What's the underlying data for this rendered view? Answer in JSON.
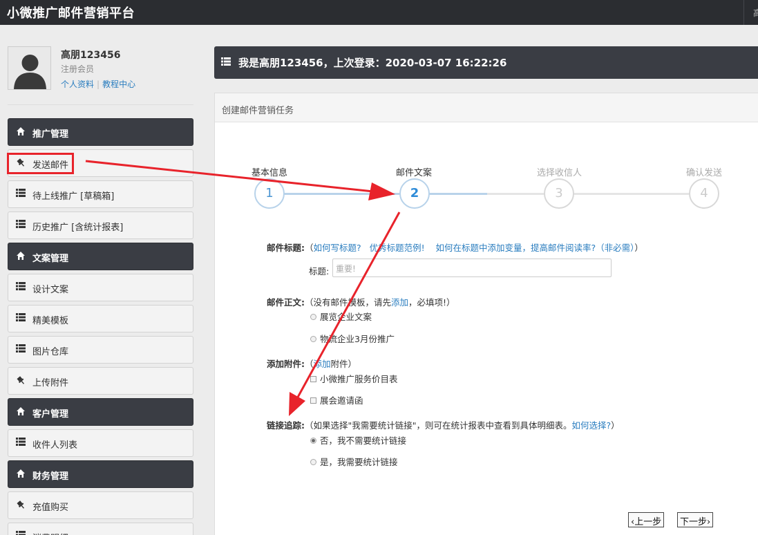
{
  "app": {
    "title": "小微推广邮件营销平台",
    "clipped_text": "高"
  },
  "profile": {
    "name": "高朋123456",
    "role": "注册会员",
    "link_profile": "个人资料",
    "link_tutorial": "教程中心",
    "separator": "|"
  },
  "sidebar": {
    "items": [
      {
        "label": "推广管理",
        "type": "head",
        "icon": "home-icon"
      },
      {
        "label": "发送邮件",
        "type": "item",
        "icon": "pushpin-icon"
      },
      {
        "label": "待上线推广 [草稿箱]",
        "type": "item",
        "icon": "list-icon"
      },
      {
        "label": "历史推广 [含统计报表]",
        "type": "item",
        "icon": "list-icon"
      },
      {
        "label": "文案管理",
        "type": "head",
        "icon": "home-icon"
      },
      {
        "label": "设计文案",
        "type": "item",
        "icon": "list-icon"
      },
      {
        "label": "精美模板",
        "type": "item",
        "icon": "list-icon"
      },
      {
        "label": "图片仓库",
        "type": "item",
        "icon": "list-icon"
      },
      {
        "label": "上传附件",
        "type": "item",
        "icon": "pushpin-icon"
      },
      {
        "label": "客户管理",
        "type": "head",
        "icon": "home-icon"
      },
      {
        "label": "收件人列表",
        "type": "item",
        "icon": "list-icon"
      },
      {
        "label": "财务管理",
        "type": "head",
        "icon": "home-icon"
      },
      {
        "label": "充值购买",
        "type": "item",
        "icon": "pushpin-icon"
      },
      {
        "label": "消费明细",
        "type": "item",
        "icon": "list-icon"
      }
    ]
  },
  "welcome": {
    "text": "我是高朋123456，上次登录：2020-03-07 16:22:26"
  },
  "panel": {
    "title": "创建邮件营销任务"
  },
  "steps": [
    {
      "label": "基本信息",
      "number": "1",
      "state": "done"
    },
    {
      "label": "邮件文案",
      "number": "2",
      "state": "active"
    },
    {
      "label": "选择收信人",
      "number": "3",
      "state": "todo"
    },
    {
      "label": "确认发送",
      "number": "4",
      "state": "todo"
    }
  ],
  "form": {
    "subject": {
      "label": "邮件标题:",
      "open": "（",
      "link1": "如何写标题?",
      "link2": "优秀标题范例!",
      "link3": "如何在标题中添加变量，提高邮件阅读率?",
      "note": "（非必需）",
      "close": "）",
      "field_label": "标题:",
      "placeholder": "重要!"
    },
    "body": {
      "label": "邮件正文:",
      "hint_before": "（没有邮件模板，请先",
      "hint_link": "添加",
      "hint_after": "，必填项!）",
      "options": [
        "展览企业文案",
        "物流企业3月份推广"
      ]
    },
    "attachment": {
      "label": "添加附件:",
      "open": "（",
      "link": "添加",
      "after": "附件）",
      "options": [
        "小微推广服务价目表",
        "展会邀请函"
      ]
    },
    "tracking": {
      "label": "链接追踪:",
      "hint": "（如果选择\"我需要统计链接\"，则可在统计报表中查看到具体明细表。",
      "link": "如何选择?",
      "close": "）",
      "options": [
        "否，我不需要统计链接",
        "是，我需要统计链接"
      ],
      "selected": 0
    }
  },
  "nav": {
    "prev": "上一步",
    "next": "下一步"
  },
  "colors": {
    "header": "#3a3d44",
    "topbar": "#2b2d31",
    "link": "#2a7dbf",
    "annotation": "#e8232b",
    "step_active": "#2e8bd8"
  }
}
